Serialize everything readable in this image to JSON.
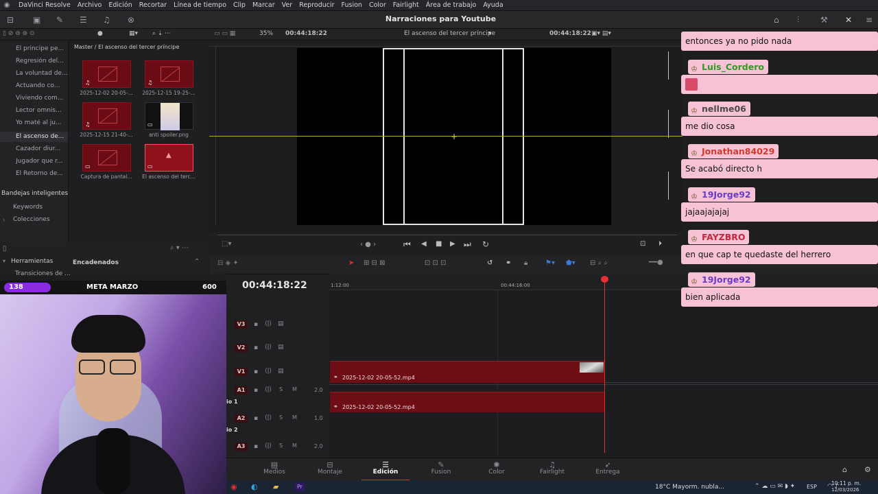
{
  "menubar": {
    "items": [
      "DaVinci Resolve",
      "Archivo",
      "Edición",
      "Recortar",
      "Línea de tiempo",
      "Clip",
      "Marcar",
      "Ver",
      "Reproducir",
      "Fusion",
      "Color",
      "Fairlight",
      "Área de trabajo",
      "Ayuda"
    ]
  },
  "toolbar": {
    "project_title": "Narraciones para Youtube"
  },
  "viewerbar": {
    "zoom": "35%",
    "timecode_left": "00:44:18:22",
    "timeline_name": "El ascenso del tercer príncipe",
    "timecode_right": "00:44:18:22"
  },
  "bins": {
    "items": [
      "El principe pe...",
      "Regresión del...",
      "La voluntad de...",
      "Actuando co...",
      "Viviendo com...",
      "Lector omnis...",
      "Yo maté al ju...",
      "El ascenso de...",
      "Cazador diur...",
      "Jugador que r...",
      "El Retorno de..."
    ],
    "smart_bins_label": "Bandejas inteligentes",
    "smart_bins": [
      "Keywords",
      "Colecciones"
    ]
  },
  "mediapool": {
    "breadcrumb": "Master / El ascenso del tercer príncipe",
    "clips": [
      {
        "caption": "2025-12-02 20-05-..."
      },
      {
        "caption": "2025-12-15 19-25-..."
      },
      {
        "caption": "2025-12-15 21-40-..."
      },
      {
        "caption": "anti spoiler.png"
      },
      {
        "caption": "Captura de pantal..."
      },
      {
        "caption": "El ascenso del terc..."
      }
    ]
  },
  "effects": {
    "tools_label": "Herramientas",
    "transitions": "Transiciones de ...",
    "linked_label": "Encadenados"
  },
  "goal": {
    "current": "138",
    "label": "META MARZO",
    "target": "600"
  },
  "timeline": {
    "timecode": "00:44:18:22",
    "ruler": [
      "1:12:00",
      "00:44:16:00"
    ],
    "tracks": [
      {
        "name": "V3"
      },
      {
        "name": "V2"
      },
      {
        "name": "V1"
      },
      {
        "name": "A1",
        "level": "2.0",
        "label": "io 1"
      },
      {
        "name": "A2",
        "level": "1.0",
        "label": "io 2"
      },
      {
        "name": "A3",
        "level": "2.0"
      }
    ],
    "clip_v1": "2025-12-02 20-05-52.mp4",
    "clip_a1": "2025-12-02 20-05-52.mp4",
    "solo": "S",
    "mute": "M"
  },
  "nav": {
    "items": [
      "Medios",
      "Montaje",
      "Edición",
      "Fusion",
      "Color",
      "Fairlight",
      "Entrega"
    ]
  },
  "taskbar": {
    "weather": "18°C  Mayorm. nubla...",
    "lang": "ESP",
    "time": "10:11 p. m.",
    "date": "12/03/2026"
  },
  "chat": [
    {
      "msg": "entonces ya no pido nada"
    },
    {
      "user": "Luis_Cordero",
      "color": "#2c9c1f",
      "msg": ""
    },
    {
      "user": "nellme06",
      "color": "#4a4a4a",
      "msg": "me dio cosa"
    },
    {
      "user": "Jonathan84029",
      "color": "#d13a2a",
      "msg": "Se acabó directo h"
    },
    {
      "user": "19Jorge92",
      "color": "#6a3bc7",
      "msg": "jajaajajajaj"
    },
    {
      "user": "FAYZBRO",
      "color": "#c0283c",
      "msg": "en que cap te quedaste del herrero"
    },
    {
      "user": "19Jorge92",
      "color": "#6a3bc7",
      "msg": "bien aplicada"
    }
  ],
  "colors": {
    "accent_clip": "#6e0d14",
    "chat_bg": "#f8c2d6",
    "playhead": "#e03030"
  }
}
